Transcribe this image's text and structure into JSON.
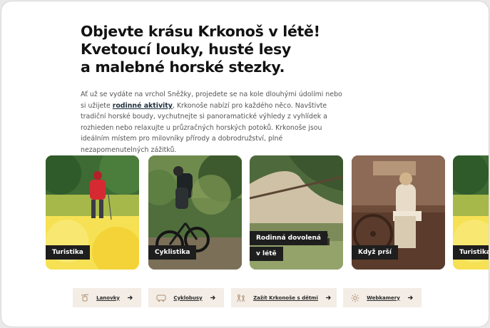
{
  "hero": {
    "title_lines": [
      "Objevte krásu Krkonoš v létě!",
      "Kvetoucí louky, husté lesy",
      "a malebné horské stezky."
    ],
    "intro_before": "Ať už se vydáte na vrchol Sněžky, projedete se na kole dlouhými údolími nebo si užijete ",
    "intro_link": "rodinné aktivity",
    "intro_after": ", Krkonoše nabízí pro každého něco. Navštivte tradiční horské boudy, vychutnejte si panoramatické výhledy z vyhlídek a rozhieden nebo relaxujte u průzračných horských potoků. Krkonoše jsou ideálním místem pro milovníky přírody a dobrodružství, plné nezapomenutelných zážitků."
  },
  "cards": [
    {
      "label": "Turistika"
    },
    {
      "label": "Cyklistika"
    },
    {
      "label_line1": "Rodinná dovolená",
      "label_line2": "v létě"
    },
    {
      "label": "Když prší"
    },
    {
      "label": "Turistika"
    }
  ],
  "links": [
    {
      "label": "Lanovky",
      "icon": "cable-car-icon"
    },
    {
      "label": "Cyklobusy",
      "icon": "bus-icon"
    },
    {
      "label": "Zažít Krkonoše s dětmi",
      "icon": "family-icon"
    },
    {
      "label": "Webkamery",
      "icon": "sun-icon"
    }
  ],
  "colors": {
    "accent_yellow": "#f2d43a",
    "label_bg": "#1e1e1e",
    "chip_bg": "#f3ede6"
  }
}
